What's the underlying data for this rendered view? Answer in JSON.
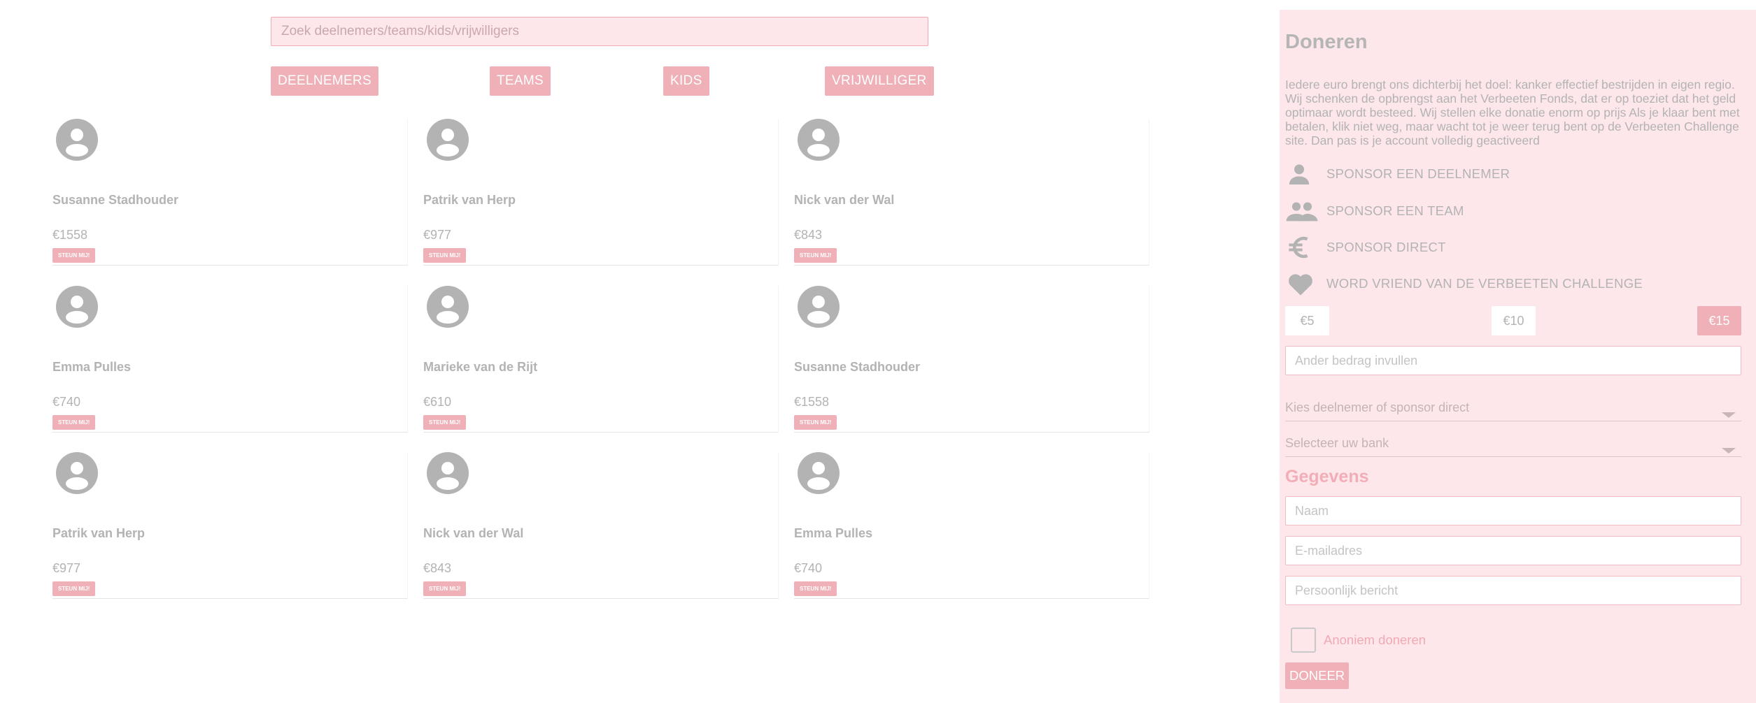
{
  "search": {
    "placeholder": "Zoek deelnemers/teams/kids/vrijwilligers"
  },
  "filters": [
    "DEELNEMERS",
    "TEAMS",
    "KIDS",
    "VRIJWILLIGER"
  ],
  "cards": [
    {
      "name": "Susanne Stadhouder",
      "amount": "€1558",
      "button": "STEUN MIJ!"
    },
    {
      "name": "Patrik van Herp",
      "amount": "€977",
      "button": "STEUN MIJ!"
    },
    {
      "name": "Nick van der Wal",
      "amount": "€843",
      "button": "STEUN MIJ!"
    },
    {
      "name": "Emma Pulles",
      "amount": "€740",
      "button": "STEUN MIJ!"
    },
    {
      "name": "Marieke van de Rijt",
      "amount": "€610",
      "button": "STEUN MIJ!"
    },
    {
      "name": "Susanne Stadhouder",
      "amount": "€1558",
      "button": "STEUN MIJ!"
    },
    {
      "name": "Patrik van Herp",
      "amount": "€977",
      "button": "STEUN MIJ!"
    },
    {
      "name": "Nick van der Wal",
      "amount": "€843",
      "button": "STEUN MIJ!"
    },
    {
      "name": "Emma Pulles",
      "amount": "€740",
      "button": "STEUN MIJ!"
    }
  ],
  "donate": {
    "title": "Doneren",
    "description": "Iedere euro brengt ons dichterbij het doel: kanker effectief bestrijden in eigen regio. Wij schenken de opbrengst aan het Verbeeten Fonds, dat er op toeziet dat het geld optimaar wordt besteed. Wij stellen elke donatie enorm op prijs Als je klaar bent met betalen, klik niet weg, maar wacht tot je weer terug bent op de Verbeeten Challenge site. Dan pas is je account volledig geactiveerd",
    "options": [
      {
        "icon": "person-icon",
        "label": "SPONSOR EEN DEELNEMER"
      },
      {
        "icon": "group-icon",
        "label": "SPONSOR EEN TEAM"
      },
      {
        "icon": "euro-icon",
        "label": "SPONSOR DIRECT"
      },
      {
        "icon": "heart-icon",
        "label": "WORD VRIEND VAN DE VERBEETEN CHALLENGE"
      }
    ],
    "amounts": [
      "€5",
      "€10",
      "€15"
    ],
    "selected_amount": "€15",
    "other_amount_placeholder": "Ander bedrag invullen",
    "participant_select": "Kies deelnemer of sponsor direct",
    "bank_select": "Selecteer uw bank",
    "details_title": "Gegevens",
    "name_placeholder": "Naam",
    "email_placeholder": "E-mailadres",
    "message_placeholder": "Persoonlijk bericht",
    "anonymous_label": "Anoniem doneren",
    "submit_label": "DONEER"
  },
  "colors": {
    "accent": "#efb1b7",
    "panel_bg": "#fde7ea",
    "icon_gray": "#b3b3b3",
    "heading_pink": "#f2aeb6"
  }
}
